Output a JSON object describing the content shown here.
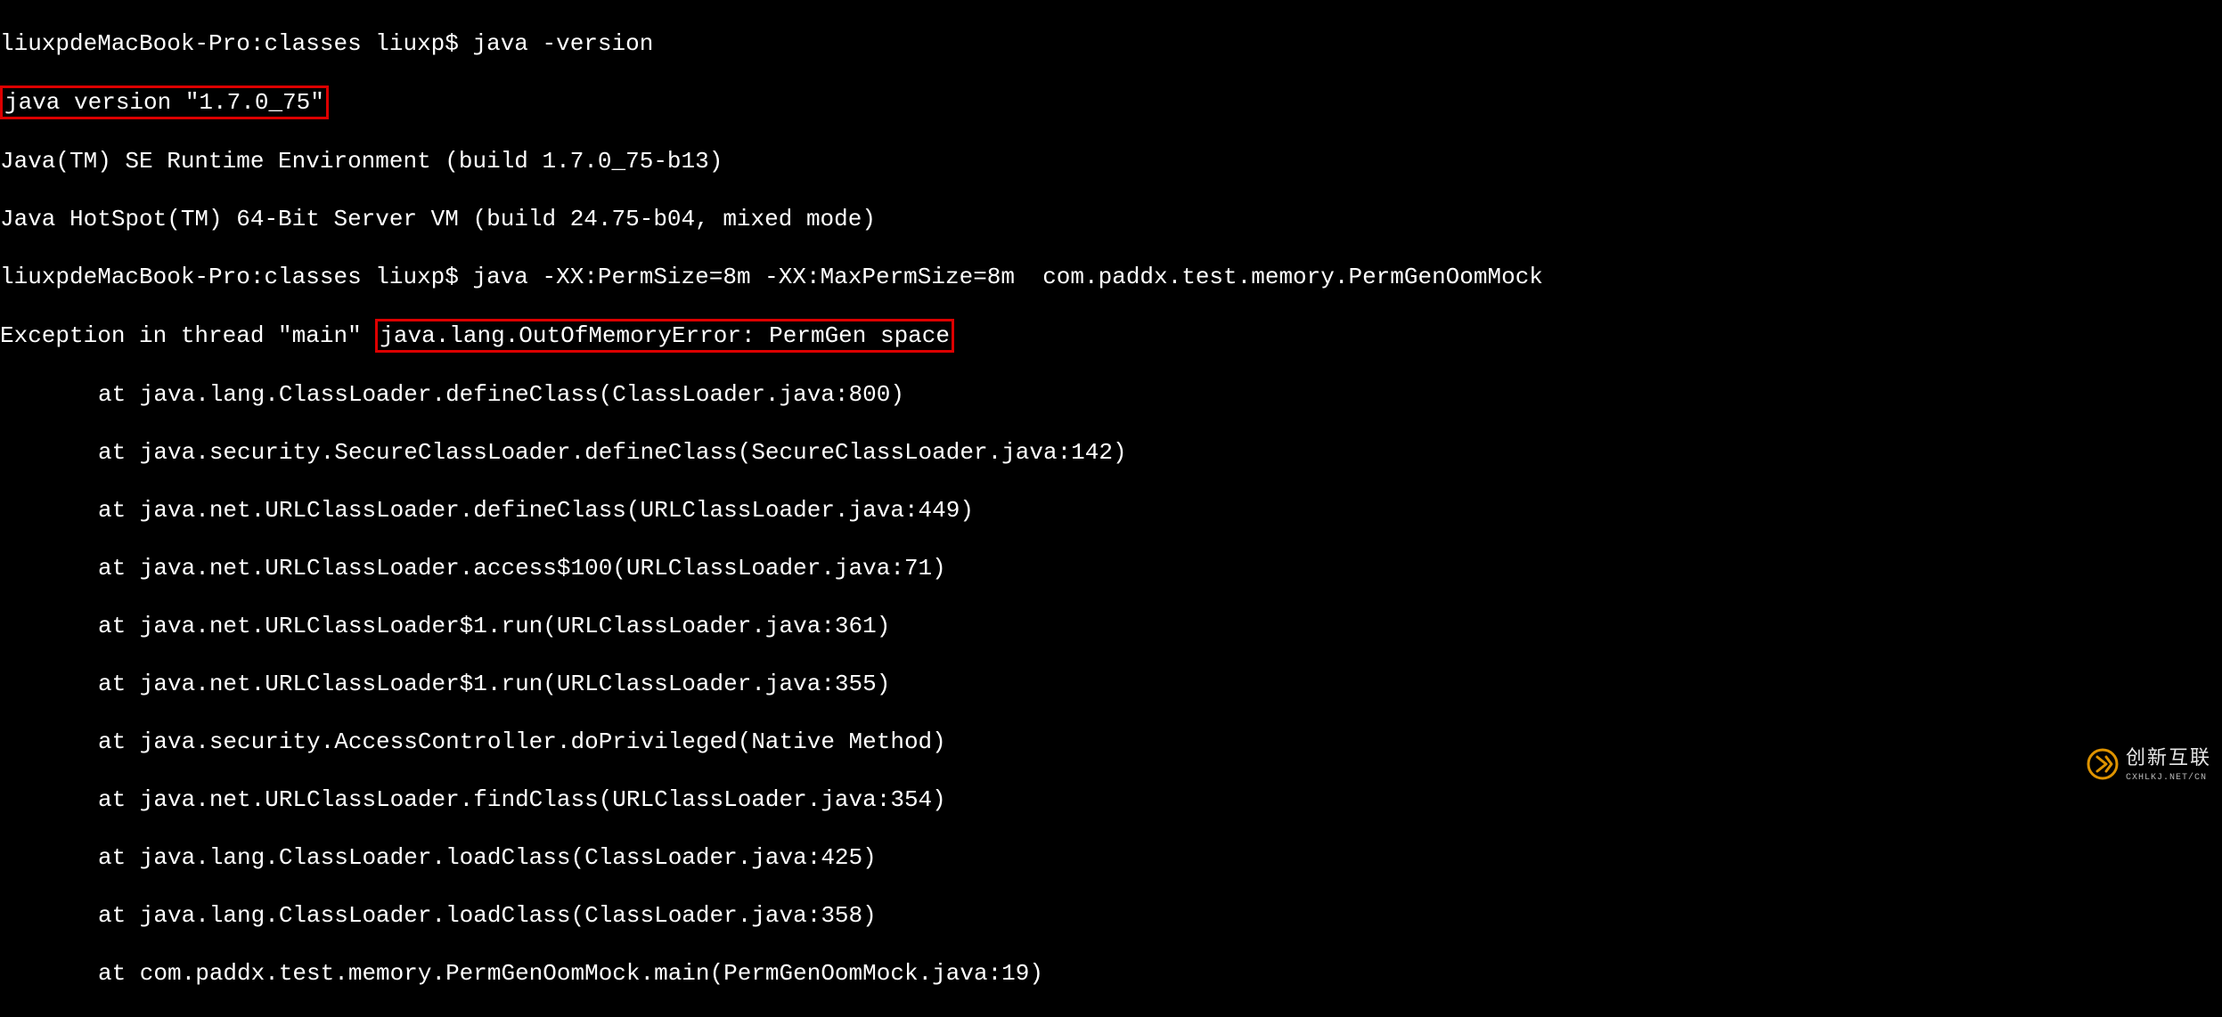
{
  "prompt1_host": "liuxpdeMacBook-Pro:classes liuxp$ ",
  "cmd1": "java -version",
  "version_line": "java version \"1.7.0_75\"",
  "jre_line": "Java(TM) SE Runtime Environment (build 1.7.0_75-b13)",
  "hotspot_line": "Java HotSpot(TM) 64-Bit Server VM (build 24.75-b04, mixed mode)",
  "prompt2_host": "liuxpdeMacBook-Pro:classes liuxp$ ",
  "cmd2": "java -XX:PermSize=8m -XX:MaxPermSize=8m  com.paddx.test.memory.PermGenOomMock",
  "exc_prefix": "Exception in thread \"main\" ",
  "exc_boxed": "java.lang.OutOfMemoryError: PermGen space",
  "stack": [
    "at java.lang.ClassLoader.defineClass(ClassLoader.java:800)",
    "at java.security.SecureClassLoader.defineClass(SecureClassLoader.java:142)",
    "at java.net.URLClassLoader.defineClass(URLClassLoader.java:449)",
    "at java.net.URLClassLoader.access$100(URLClassLoader.java:71)",
    "at java.net.URLClassLoader$1.run(URLClassLoader.java:361)",
    "at java.net.URLClassLoader$1.run(URLClassLoader.java:355)",
    "at java.security.AccessController.doPrivileged(Native Method)",
    "at java.net.URLClassLoader.findClass(URLClassLoader.java:354)",
    "at java.lang.ClassLoader.loadClass(ClassLoader.java:425)",
    "at java.lang.ClassLoader.loadClass(ClassLoader.java:358)",
    "at com.paddx.test.memory.PermGenOomMock.main(PermGenOomMock.java:19)"
  ],
  "watermark_text": "创新互联",
  "watermark_sub": "CXHLKJ.NET/CN"
}
